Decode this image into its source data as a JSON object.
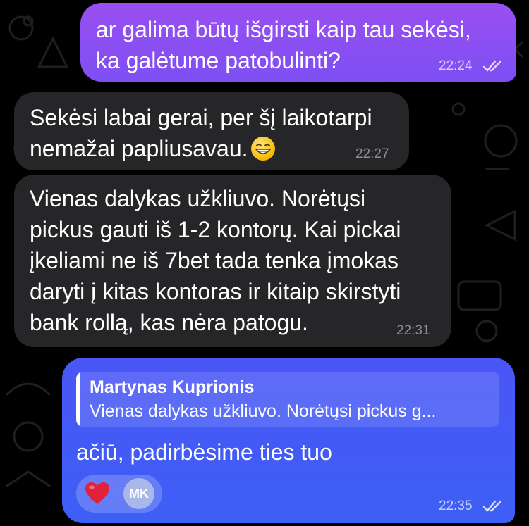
{
  "messages": [
    {
      "text": "ar galima būtų išgirsti kaip tau sekėsi,\nka galėtume patobulinti?",
      "time": "22:24",
      "direction": "outgoing",
      "status": "read"
    },
    {
      "text": "Sekėsi labai gerai, per šį laikotarpi\nnemažai papliusavau.",
      "emoji": "grinning-face",
      "time": "22:27",
      "direction": "incoming"
    },
    {
      "text": "Vienas dalykas užkliuvo. Norėtųsi\npickus gauti iš 1-2 kontorų. Kai pickai\nįkeliami ne iš 7bet tada tenka įmokas\ndaryti į kitas kontoras ir kitaip skirstyti\nbank rollą, kas nėra patogu.",
      "time": "22:31",
      "direction": "incoming"
    },
    {
      "reply_to": {
        "name": "Martynas Kuprionis",
        "preview": "Vienas dalykas užkliuvo. Norėtųsi pickus g..."
      },
      "text": "ačiū, padirbėsime ties tuo",
      "time": "22:35",
      "direction": "outgoing",
      "status": "read",
      "reactions": [
        {
          "icon": "heart-icon",
          "avatar_initials": "MK"
        }
      ]
    }
  ],
  "colors": {
    "background": "#000000",
    "outgoing_bubble": "#8a4ff1",
    "outgoing_bubble_blue": "#3f5cf6",
    "incoming_bubble": "#262628",
    "wallpaper_doodle": "#1c1c1e"
  }
}
